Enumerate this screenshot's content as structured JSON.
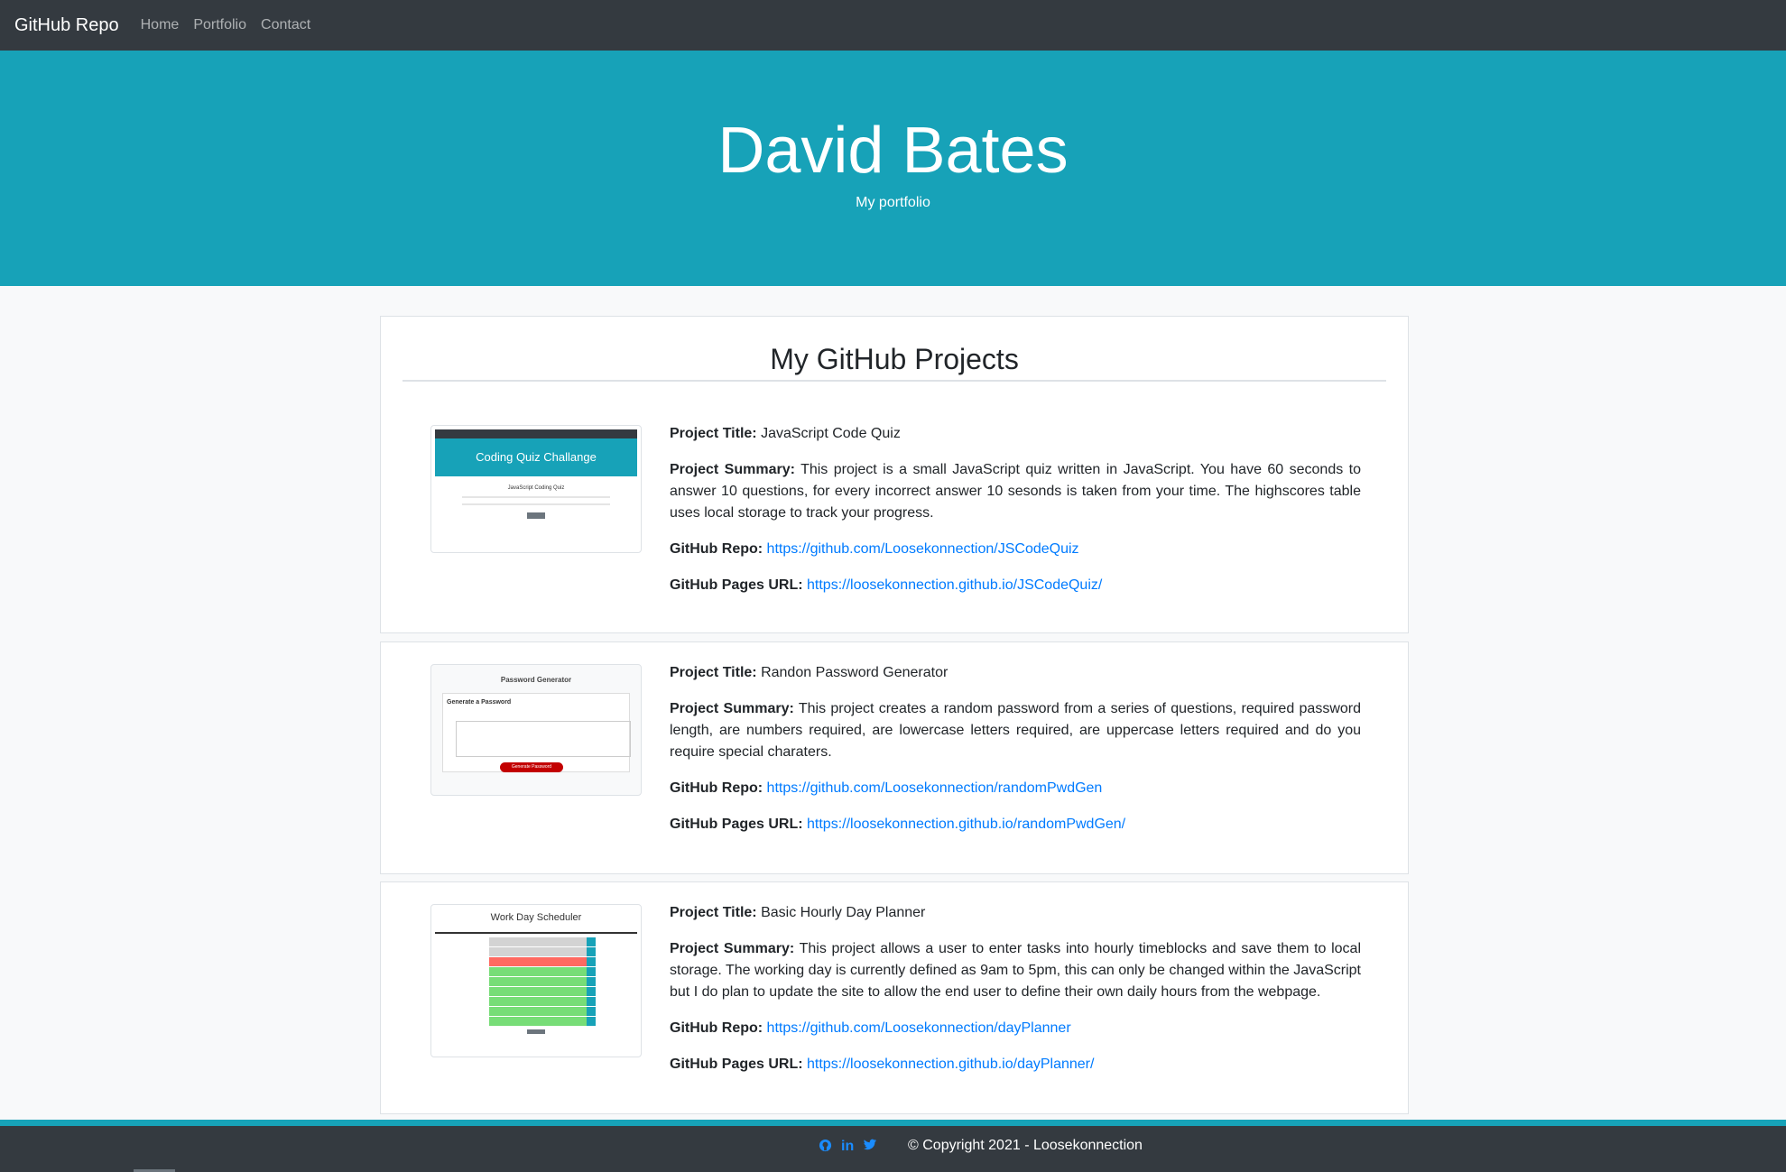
{
  "nav": {
    "brand": "GitHub Repo",
    "links": [
      "Home",
      "Portfolio",
      "Contact"
    ]
  },
  "hero": {
    "title": "David Bates",
    "subtitle": "My portfolio"
  },
  "section": {
    "title": "My GitHub Projects"
  },
  "labels": {
    "title": "Project Title:",
    "summary": "Project Summary:",
    "repo": "GitHub Repo:",
    "pages": "GitHub Pages URL:"
  },
  "projects": [
    {
      "title": "JavaScript Code Quiz",
      "summary": "This project is a small JavaScript quiz written in JavaScript. You have 60 seconds to answer 10 questions, for every incorrect answer 10 sesonds is taken from your time. The highscores table uses local storage to track your progress.",
      "repo": "https://github.com/Loosekonnection/JSCodeQuiz",
      "pages": "https://loosekonnection.github.io/JSCodeQuiz/",
      "thumb_title": "Coding Quiz Challange",
      "thumb_sub": "JavaScript Coding Quiz"
    },
    {
      "title": "Randon Password Generator",
      "summary": "This project creates a random password from a series of questions, required password length, are numbers required, are lowercase letters required, are uppercase letters required and do you require special charaters.",
      "repo": "https://github.com/Loosekonnection/randomPwdGen",
      "pages": "https://loosekonnection.github.io/randomPwdGen/",
      "thumb_title": "Password Generator",
      "thumb_sub": "Generate a Password",
      "thumb_btn": "Generate Password"
    },
    {
      "title": "Basic Hourly Day Planner",
      "summary": "This project allows a user to enter tasks into hourly timeblocks and save them to local storage. The working day is currently defined as 9am to 5pm, this can only be changed within the JavaScript but I do plan to update the site to allow the end user to define their own daily hours from the webpage.",
      "repo": "https://github.com/Loosekonnection/dayPlanner",
      "pages": "https://loosekonnection.github.io/dayPlanner/",
      "thumb_title": "Work Day Scheduler"
    }
  ],
  "footer": {
    "copyright": "© Copyright 2021 - Loosekonnection",
    "icons": [
      "github-icon",
      "linkedin-icon",
      "twitter-icon"
    ]
  },
  "colors": {
    "navbar": "#343a40",
    "hero": "#17a2b8",
    "link": "#007bff"
  }
}
